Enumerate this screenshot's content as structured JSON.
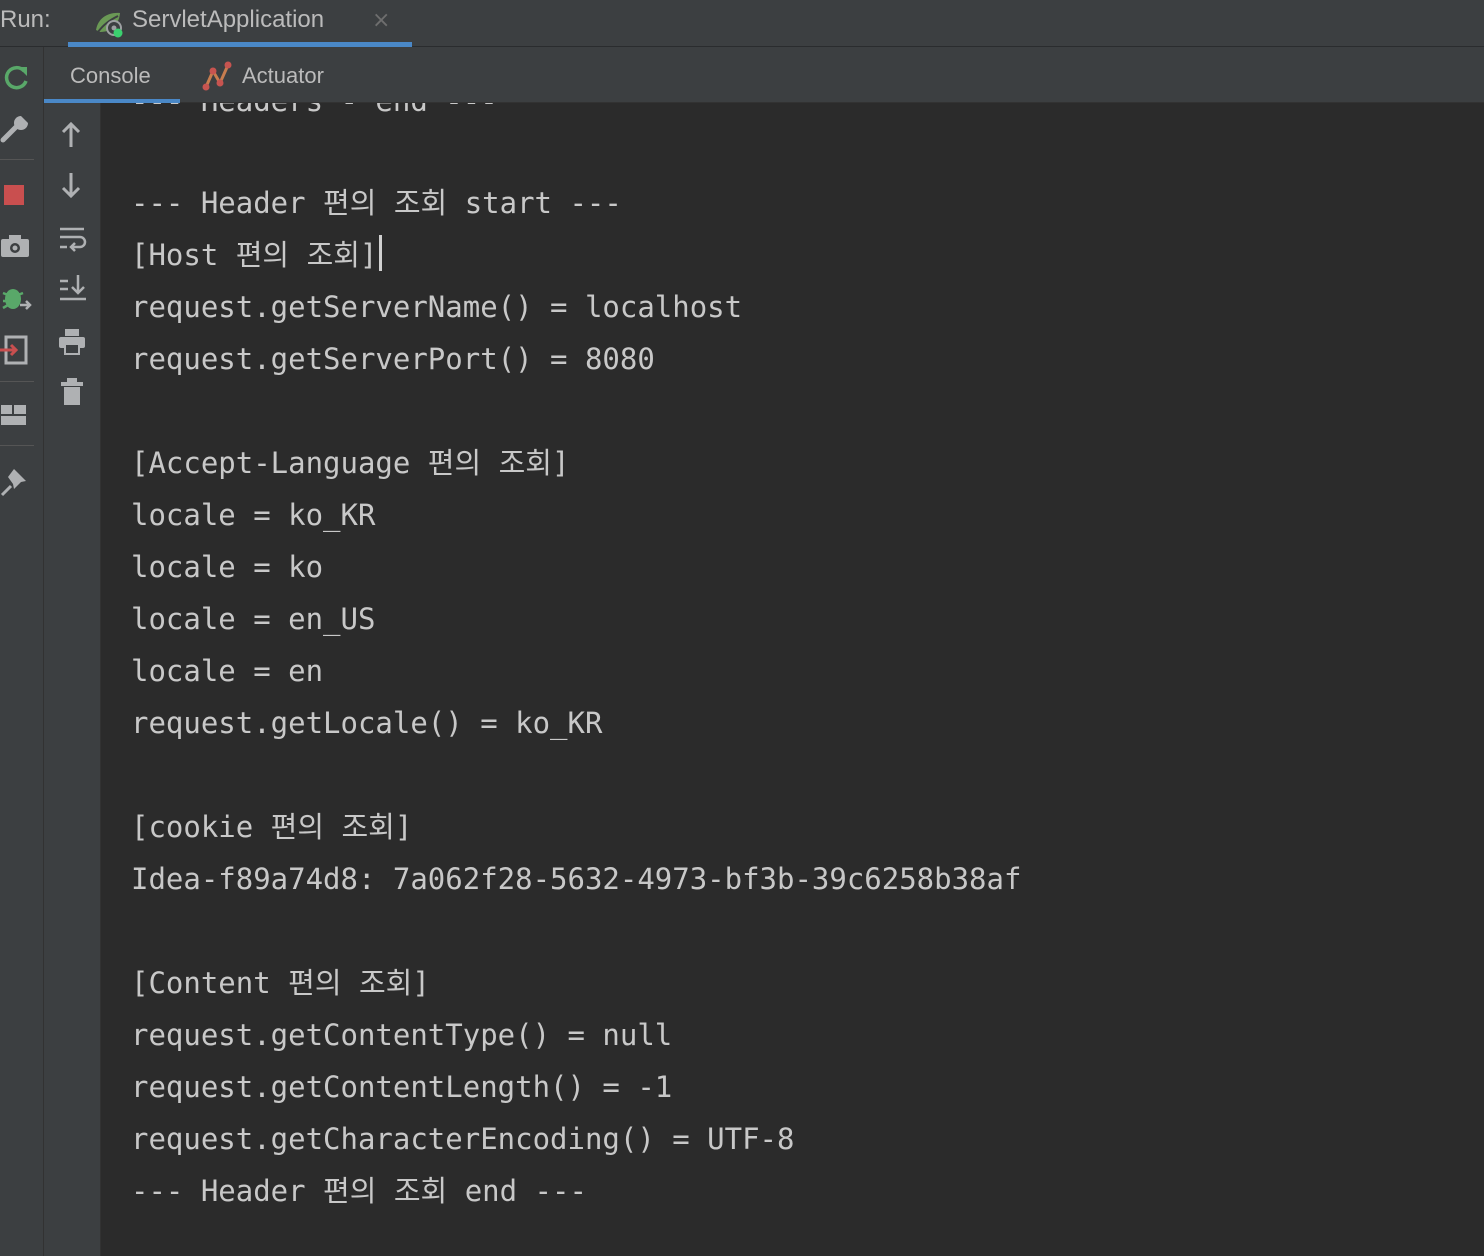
{
  "run_bar": {
    "label": "Run:",
    "tab": {
      "title": "ServletApplication",
      "icon": "spring-boot-run-icon",
      "close": "×"
    }
  },
  "left_toolbar": {
    "icons": [
      "rerun-icon",
      "wrench-icon",
      "stop-icon",
      "camera-icon",
      "debug-icon",
      "exit-icon",
      "layout-icon",
      "pin-icon"
    ]
  },
  "tabs": [
    {
      "label": "Console",
      "active": true
    },
    {
      "label": "Actuator",
      "icon": "actuator-icon",
      "active": false
    }
  ],
  "console_toolbar": {
    "icons": [
      "up-arrow-icon",
      "down-arrow-icon",
      "soft-wrap-icon",
      "scroll-to-end-icon",
      "print-icon",
      "trash-icon"
    ]
  },
  "console": {
    "lines": [
      "--- Headers - end ---",
      "",
      "--- Header 편의 조회 start ---",
      "[Host 편의 조회]",
      "request.getServerName() = localhost",
      "request.getServerPort() = 8080",
      "",
      "[Accept-Language 편의 조회]",
      "locale = ko_KR",
      "locale = ko",
      "locale = en_US",
      "locale = en",
      "request.getLocale() = ko_KR",
      "",
      "[cookie 편의 조회]",
      "Idea-f89a74d8: 7a062f28-5632-4973-bf3b-39c6258b38af",
      "",
      "[Content 편의 조회]",
      "request.getContentType() = null",
      "request.getContentLength() = -1",
      "request.getCharacterEncoding() = UTF-8",
      "--- Header 편의 조회 end ---"
    ]
  },
  "colors": {
    "background": "#2b2b2b",
    "panel": "#3c3f41",
    "text": "#c8c8c8",
    "accent": "#4a88c7",
    "stop": "#c94f4f",
    "run_green": "#59a869",
    "actuator_orange": "#c75450"
  }
}
